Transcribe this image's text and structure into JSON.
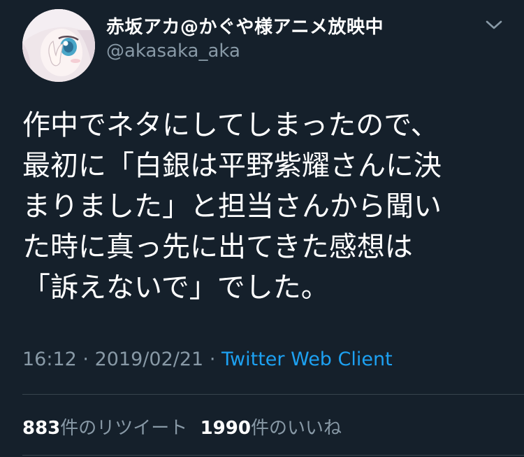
{
  "user": {
    "display_name": "赤坂アカ@かぐや様アニメ放映中",
    "handle": "@akasaka_aka"
  },
  "tweet": {
    "lines": [
      "作中でネタにしてしまったので、",
      "最初に「白銀は平野紫耀さんに決",
      "まりました」と担当さんから聞い",
      "た時に真っ先に出てきた感想は",
      "「訴えないで」でした。"
    ]
  },
  "meta": {
    "time": "16:12",
    "separator": "·",
    "date": "2019/02/21",
    "source": "Twitter Web Client"
  },
  "stats": {
    "retweets_count": "883",
    "retweets_label": "件のリツイート",
    "likes_count": "1990",
    "likes_label": "件のいいね"
  },
  "icons": {
    "menu": "chevron-down-icon",
    "avatar": "profile-avatar"
  },
  "colors": {
    "background": "#15202b",
    "text_primary": "#ffffff",
    "text_secondary": "#8899a6",
    "accent": "#1da1f2",
    "divider": "#38444d"
  }
}
